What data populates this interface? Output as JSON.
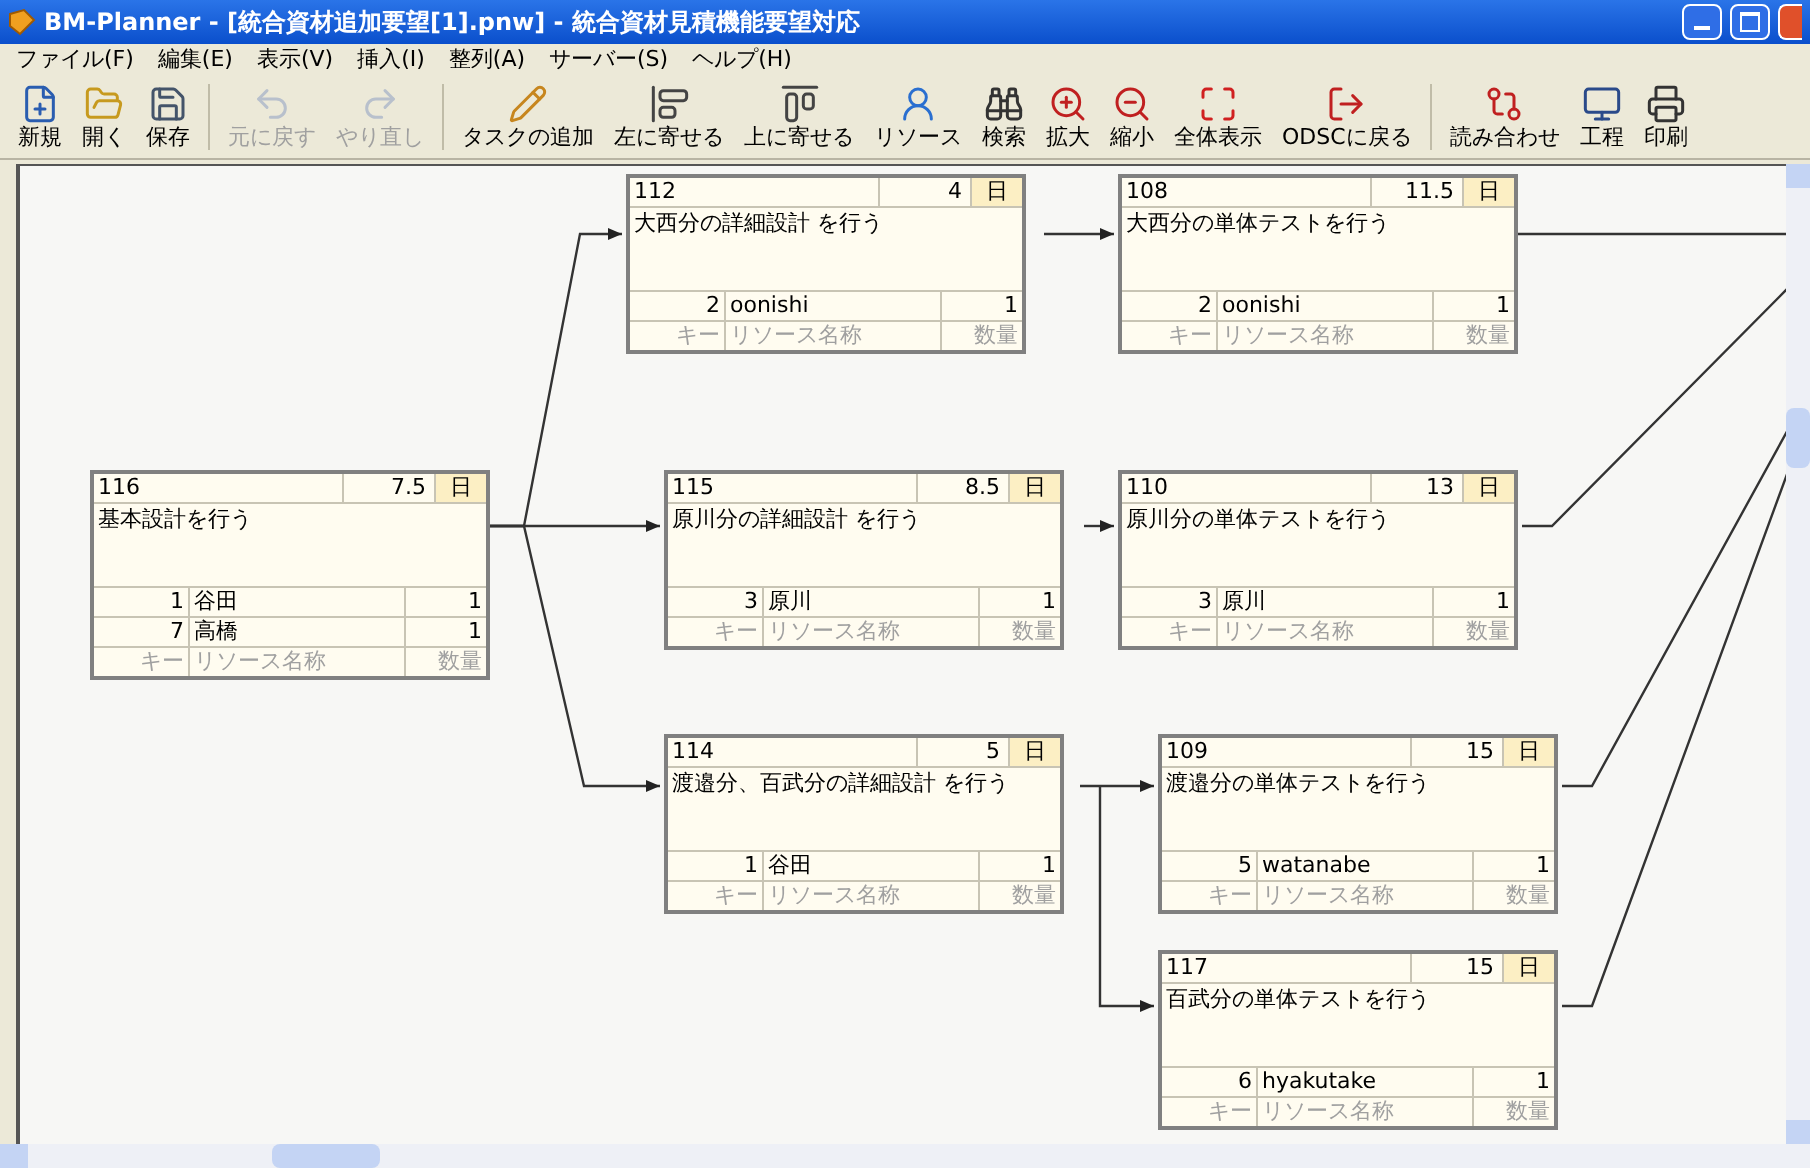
{
  "window": {
    "title": "BM-Planner - [統合資材追加要望[1].pnw] - 統合資材見積機能要望対応"
  },
  "menu": [
    "ファイル(F)",
    "編集(E)",
    "表示(V)",
    "挿入(I)",
    "整列(A)",
    "サーバー(S)",
    "ヘルプ(H)"
  ],
  "toolbar": [
    [
      {
        "label": "新規",
        "disabled": false
      },
      {
        "label": "開く",
        "disabled": false
      },
      {
        "label": "保存",
        "disabled": false
      }
    ],
    [
      {
        "label": "元に戻す",
        "disabled": true
      },
      {
        "label": "やり直し",
        "disabled": true
      }
    ],
    [
      {
        "label": "タスクの追加",
        "disabled": false
      },
      {
        "label": "左に寄せる",
        "disabled": false
      },
      {
        "label": "上に寄せる",
        "disabled": false
      },
      {
        "label": "リソース",
        "disabled": false
      },
      {
        "label": "検索",
        "disabled": false
      },
      {
        "label": "拡大",
        "disabled": false
      },
      {
        "label": "縮小",
        "disabled": false
      },
      {
        "label": "全体表示",
        "disabled": false
      },
      {
        "label": "ODSCに戻る",
        "disabled": false
      }
    ],
    [
      {
        "label": "読み合わせ",
        "disabled": false
      },
      {
        "label": "工程",
        "disabled": false
      },
      {
        "label": "印刷",
        "disabled": false
      }
    ]
  ],
  "tasks": [
    {
      "id": "112",
      "duration": "4",
      "unit": "日",
      "title": "大西分の詳細設計 を行う",
      "resources": [
        {
          "key": "2",
          "name": "oonishi",
          "qty": "1"
        }
      ],
      "footer": {
        "key": "キー",
        "name": "リソース名称",
        "qty": "数量"
      }
    },
    {
      "id": "108",
      "duration": "11.5",
      "unit": "日",
      "title": "大西分の単体テストを行う",
      "resources": [
        {
          "key": "2",
          "name": "oonishi",
          "qty": "1"
        }
      ],
      "footer": {
        "key": "キー",
        "name": "リソース名称",
        "qty": "数量"
      }
    },
    {
      "id": "116",
      "duration": "7.5",
      "unit": "日",
      "title": "基本設計を行う",
      "resources": [
        {
          "key": "1",
          "name": "谷田",
          "qty": "1"
        },
        {
          "key": "7",
          "name": "高橋",
          "qty": "1"
        }
      ],
      "footer": {
        "key": "キー",
        "name": "リソース名称",
        "qty": "数量"
      }
    },
    {
      "id": "115",
      "duration": "8.5",
      "unit": "日",
      "title": "原川分の詳細設計 を行う",
      "resources": [
        {
          "key": "3",
          "name": "原川",
          "qty": "1"
        }
      ],
      "footer": {
        "key": "キー",
        "name": "リソース名称",
        "qty": "数量"
      }
    },
    {
      "id": "110",
      "duration": "13",
      "unit": "日",
      "title": "原川分の単体テストを行う",
      "resources": [
        {
          "key": "3",
          "name": "原川",
          "qty": "1"
        }
      ],
      "footer": {
        "key": "キー",
        "name": "リソース名称",
        "qty": "数量"
      }
    },
    {
      "id": "114",
      "duration": "5",
      "unit": "日",
      "title": "渡邉分、百武分の詳細設計 を行う",
      "resources": [
        {
          "key": "1",
          "name": "谷田",
          "qty": "1"
        }
      ],
      "footer": {
        "key": "キー",
        "name": "リソース名称",
        "qty": "数量"
      }
    },
    {
      "id": "109",
      "duration": "15",
      "unit": "日",
      "title": "渡邉分の単体テストを行う",
      "resources": [
        {
          "key": "5",
          "name": "watanabe",
          "qty": "1"
        }
      ],
      "footer": {
        "key": "キー",
        "name": "リソース名称",
        "qty": "数量"
      }
    },
    {
      "id": "117",
      "duration": "15",
      "unit": "日",
      "title": "百武分の単体テストを行う",
      "resources": [
        {
          "key": "6",
          "name": "hyakutake",
          "qty": "1"
        }
      ],
      "footer": {
        "key": "キー",
        "name": "リソース名称",
        "qty": "数量"
      }
    }
  ]
}
